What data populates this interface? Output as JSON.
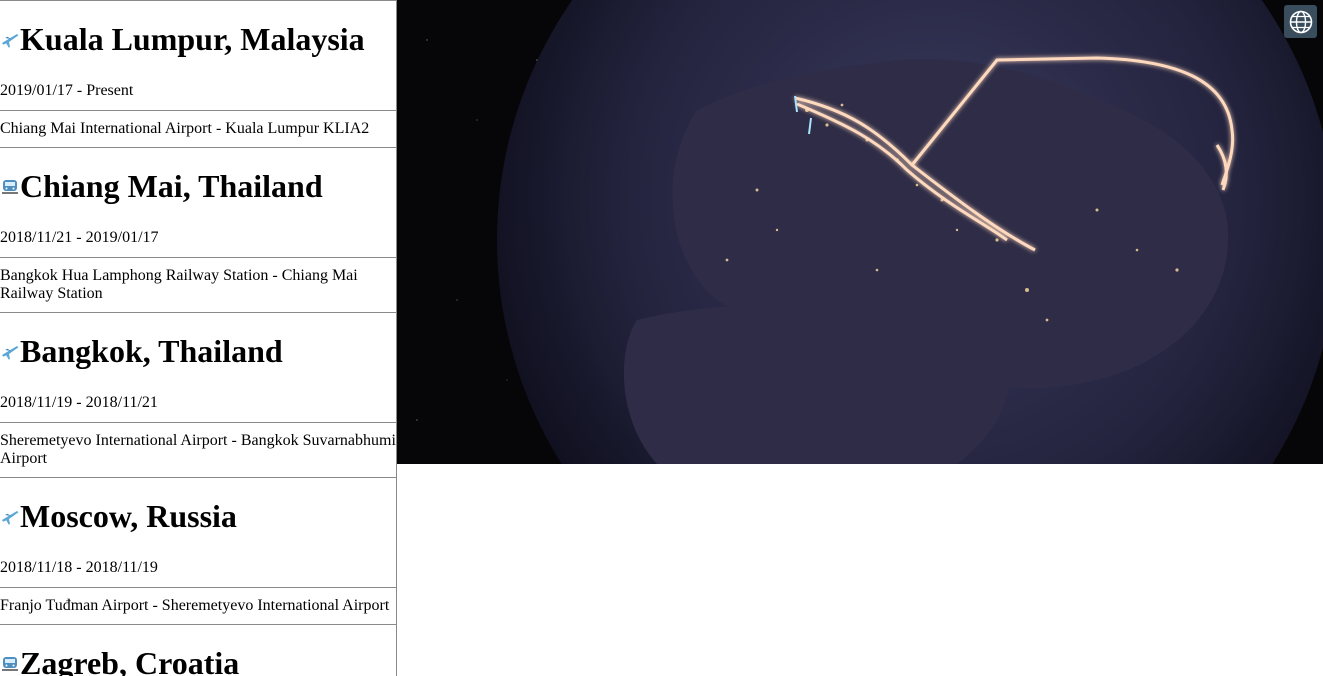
{
  "trips": [
    {
      "mode": "airplane-icon",
      "title": "Kuala Lumpur, Malaysia",
      "dates": "2019/01/17 - Present",
      "route": "Chiang Mai International Airport - Kuala Lumpur KLIA2"
    },
    {
      "mode": "train-icon",
      "title": "Chiang Mai, Thailand",
      "dates": "2018/11/21 - 2019/01/17",
      "route": "Bangkok Hua Lamphong Railway Station - Chiang Mai Railway Station"
    },
    {
      "mode": "airplane-icon",
      "title": "Bangkok, Thailand",
      "dates": "2018/11/19 - 2018/11/21",
      "route": "Sheremetyevo International Airport - Bangkok Suvarnabhumi Airport"
    },
    {
      "mode": "airplane-icon",
      "title": "Moscow, Russia",
      "dates": "2018/11/18 - 2018/11/19",
      "route": "Franjo Tuđman Airport - Sheremetyevo International Airport"
    },
    {
      "mode": "train-icon",
      "title": "Zagreb, Croatia",
      "dates": "",
      "route": ""
    }
  ],
  "globe": {
    "toggle_icon": "globe-icon",
    "route_color": "#ffb48a"
  }
}
